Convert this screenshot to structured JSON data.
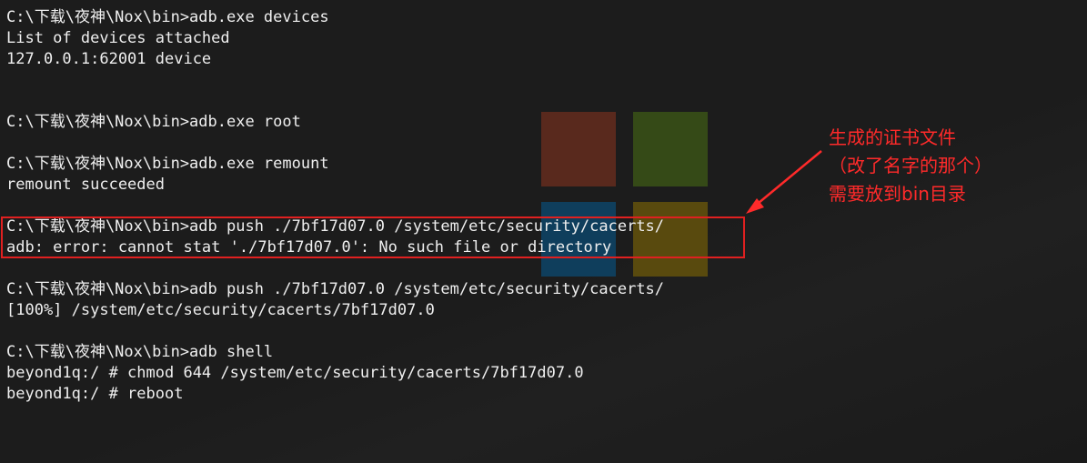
{
  "terminal": {
    "lines": [
      "C:\\下载\\夜神\\Nox\\bin>adb.exe devices",
      "List of devices attached",
      "127.0.0.1:62001 device",
      "",
      "",
      "C:\\下载\\夜神\\Nox\\bin>adb.exe root",
      "",
      "C:\\下载\\夜神\\Nox\\bin>adb.exe remount",
      "remount succeeded",
      "",
      "C:\\下载\\夜神\\Nox\\bin>adb push ./7bf17d07.0 /system/etc/security/cacerts/",
      "adb: error: cannot stat './7bf17d07.0': No such file or directory",
      "",
      "C:\\下载\\夜神\\Nox\\bin>adb push ./7bf17d07.0 /system/etc/security/cacerts/",
      "[100%] /system/etc/security/cacerts/7bf17d07.0",
      "",
      "C:\\下载\\夜神\\Nox\\bin>adb shell",
      "beyond1q:/ # chmod 644 /system/etc/security/cacerts/7bf17d07.0",
      "beyond1q:/ # reboot"
    ]
  },
  "annotation": {
    "line1": "生成的证书文件",
    "line2": "（改了名字的那个）",
    "line3": "需要放到bin目录"
  },
  "colors": {
    "background": "#1c1c1c",
    "text": "#efefef",
    "annotation": "#ff2a2a",
    "logo_red": "#6e2e1e",
    "logo_green": "#3e5a16",
    "logo_blue": "#0b4a72",
    "logo_yellow": "#6e5a0a"
  }
}
